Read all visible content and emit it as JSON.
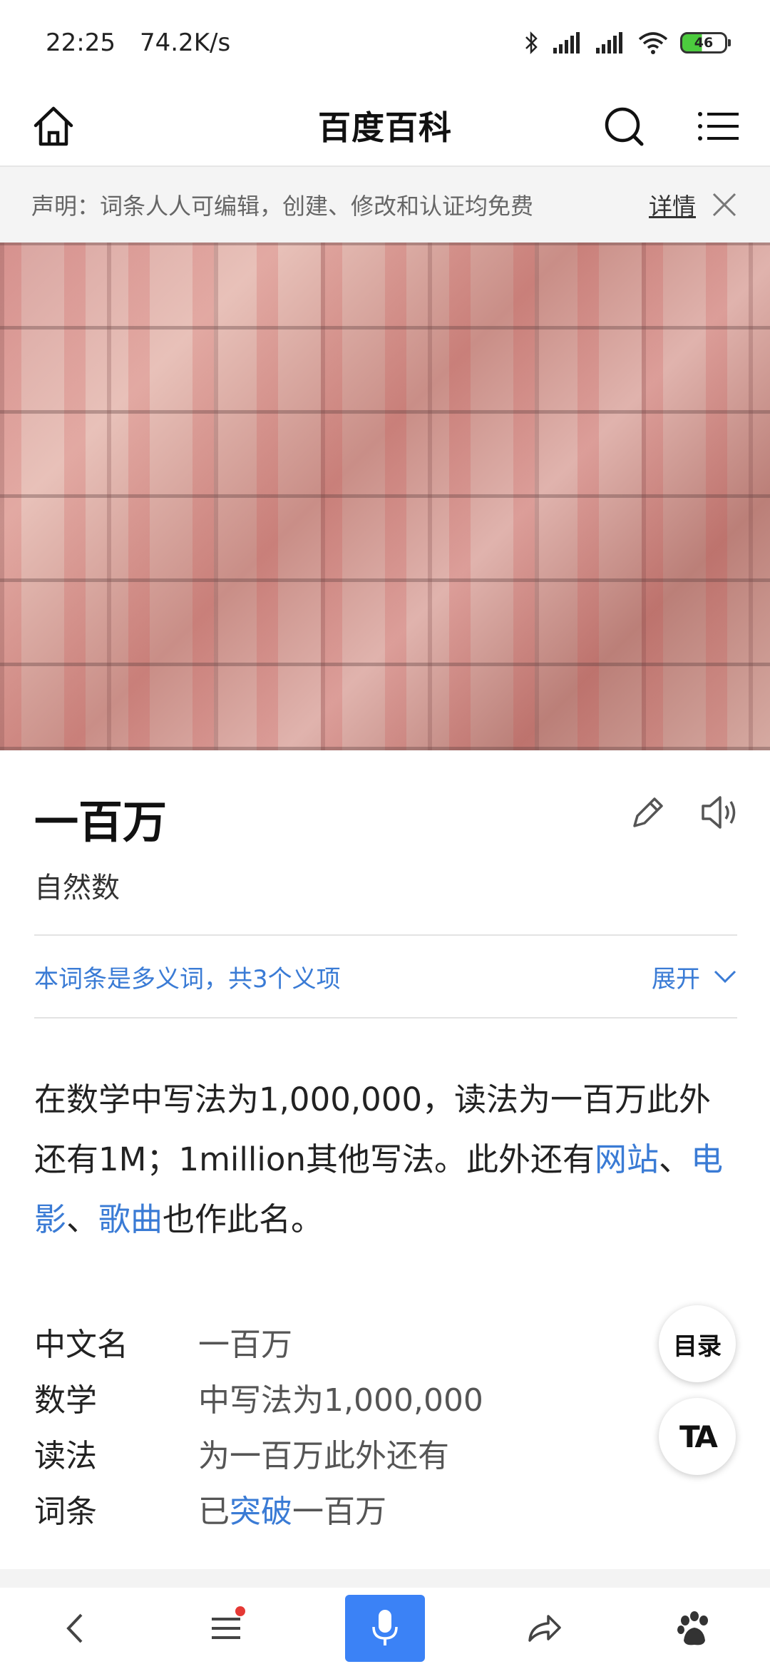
{
  "status": {
    "time": "22:25",
    "speed": "74.2K/s",
    "battery": "46"
  },
  "header": {
    "title": "百度百科"
  },
  "notice": {
    "text": "声明：词条人人可编辑，创建、修改和认证均免费",
    "detail": "详情"
  },
  "entry": {
    "title": "一百万",
    "subtitle": "自然数",
    "polysemy": "本词条是多义词，共3个义项",
    "expand": "展开"
  },
  "summary": {
    "part1": "在数学中写法为1,000,000，读法为一百万此外还有1M；1million其他写法。此外还有",
    "link1": "网站",
    "sep1": "、",
    "link2": "电影",
    "sep2": "、",
    "link3": "歌曲",
    "part2": "也作此名。"
  },
  "basic_info": {
    "rows": [
      {
        "key": "中文名",
        "value": "一百万"
      },
      {
        "key": "数学",
        "value": "中写法为1,000,000"
      },
      {
        "key": "读法",
        "value": "为一百万此外还有"
      }
    ],
    "last": {
      "key": "词条",
      "prefix": "已",
      "link": "突破",
      "suffix": "一百万"
    }
  },
  "fab": {
    "toc": "目录",
    "font": "TA"
  },
  "colors": {
    "link": "#3a7bd5",
    "mic": "#3b82f6",
    "badge": "#e53935"
  }
}
